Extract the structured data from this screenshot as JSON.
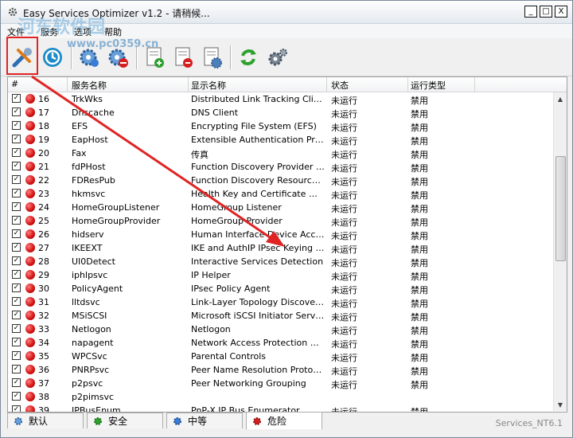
{
  "window": {
    "title": "Easy Services Optimizer v1.2 - 请稍候...",
    "buttons": {
      "minimize": "_",
      "maximize": "□",
      "close": "X"
    }
  },
  "menu": [
    "文件",
    "服务",
    "选项",
    "帮助"
  ],
  "toolbar": {
    "buttons": [
      "optimize-icon",
      "restore-icon",
      "service-settings-icon",
      "service-stop-icon",
      "list-add-icon",
      "list-remove-icon",
      "list-edit-icon",
      "refresh-icon",
      "settings-gear-icon"
    ]
  },
  "table": {
    "headers": [
      "#",
      "服务名称",
      "显示名称",
      "状态",
      "运行类型"
    ],
    "rows": [
      {
        "num": "16",
        "name": "TrkWks",
        "display": "Distributed Link Tracking Client",
        "status": "未运行",
        "type": "禁用"
      },
      {
        "num": "17",
        "name": "Dnscache",
        "display": "DNS Client",
        "status": "未运行",
        "type": "禁用"
      },
      {
        "num": "18",
        "name": "EFS",
        "display": "Encrypting File System (EFS)",
        "status": "未运行",
        "type": "禁用"
      },
      {
        "num": "19",
        "name": "EapHost",
        "display": "Extensible Authentication Proto...",
        "status": "未运行",
        "type": "禁用"
      },
      {
        "num": "20",
        "name": "Fax",
        "display": "传真",
        "status": "未运行",
        "type": "禁用"
      },
      {
        "num": "21",
        "name": "fdPHost",
        "display": "Function Discovery Provider Host",
        "status": "未运行",
        "type": "禁用"
      },
      {
        "num": "22",
        "name": "FDResPub",
        "display": "Function Discovery Resource P...",
        "status": "未运行",
        "type": "禁用"
      },
      {
        "num": "23",
        "name": "hkmsvc",
        "display": "Health Key and Certificate Man...",
        "status": "未运行",
        "type": "禁用"
      },
      {
        "num": "24",
        "name": "HomeGroupListener",
        "display": "HomeGroup Listener",
        "status": "未运行",
        "type": "禁用"
      },
      {
        "num": "25",
        "name": "HomeGroupProvider",
        "display": "HomeGroup Provider",
        "status": "未运行",
        "type": "禁用"
      },
      {
        "num": "26",
        "name": "hidserv",
        "display": "Human Interface Device Access",
        "status": "未运行",
        "type": "禁用"
      },
      {
        "num": "27",
        "name": "IKEEXT",
        "display": "IKE and AuthIP IPsec Keying M...",
        "status": "未运行",
        "type": "禁用"
      },
      {
        "num": "28",
        "name": "UI0Detect",
        "display": "Interactive Services Detection",
        "status": "未运行",
        "type": "禁用"
      },
      {
        "num": "29",
        "name": "iphlpsvc",
        "display": "IP Helper",
        "status": "未运行",
        "type": "禁用"
      },
      {
        "num": "30",
        "name": "PolicyAgent",
        "display": "IPsec Policy Agent",
        "status": "未运行",
        "type": "禁用"
      },
      {
        "num": "31",
        "name": "lltdsvc",
        "display": "Link-Layer Topology Discovery ...",
        "status": "未运行",
        "type": "禁用"
      },
      {
        "num": "32",
        "name": "MSiSCSI",
        "display": "Microsoft iSCSI Initiator Service",
        "status": "未运行",
        "type": "禁用"
      },
      {
        "num": "33",
        "name": "Netlogon",
        "display": "Netlogon",
        "status": "未运行",
        "type": "禁用"
      },
      {
        "num": "34",
        "name": "napagent",
        "display": "Network Access Protection Agent",
        "status": "未运行",
        "type": "禁用"
      },
      {
        "num": "35",
        "name": "WPCSvc",
        "display": "Parental Controls",
        "status": "未运行",
        "type": "禁用"
      },
      {
        "num": "36",
        "name": "PNRPsvc",
        "display": "Peer Name Resolution Protocol",
        "status": "未运行",
        "type": "禁用"
      },
      {
        "num": "37",
        "name": "p2psvc",
        "display": "Peer Networking Grouping",
        "status": "未运行",
        "type": "禁用"
      },
      {
        "num": "38",
        "name": "p2pimsvc",
        "display": "",
        "status": "",
        "type": ""
      },
      {
        "num": "39",
        "name": "IPBusEnum",
        "display": "PnP-X IP Bus Enumerator",
        "status": "未运行",
        "type": "禁用"
      }
    ]
  },
  "tabs": [
    {
      "label": "默认"
    },
    {
      "label": "安全"
    },
    {
      "label": "中等"
    },
    {
      "label": "危险"
    }
  ],
  "status_right": "Services_NT6.1",
  "watermark": {
    "line1": "河东软件园",
    "line2": "www.pc0359.cn"
  },
  "colors": {
    "accent_red": "#e02424",
    "status_dot": "#d01010"
  }
}
